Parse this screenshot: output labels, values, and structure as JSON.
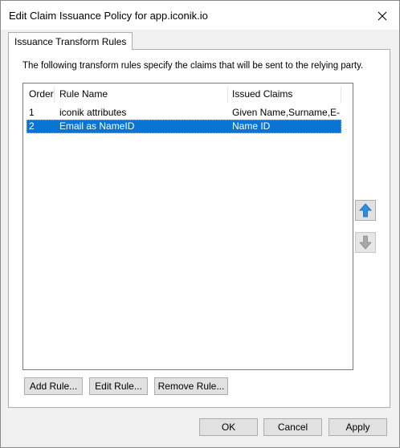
{
  "window": {
    "title": "Edit Claim Issuance Policy for app.iconik.io"
  },
  "tabs": [
    {
      "label": "Issuance Transform Rules"
    }
  ],
  "panel": {
    "description": "The following transform rules specify the claims that will be sent to the relying party."
  },
  "rules_table": {
    "columns": [
      "Order",
      "Rule Name",
      "Issued Claims"
    ],
    "rows": [
      {
        "order": "1",
        "name": "iconik attributes",
        "claims": "Given Name,Surname,E-...",
        "selected": false
      },
      {
        "order": "2",
        "name": "Email as NameID",
        "claims": "Name ID",
        "selected": true
      }
    ]
  },
  "move_buttons": {
    "up": {
      "icon": "arrow-up-icon",
      "enabled": true,
      "color": "#2e8fe0"
    },
    "down": {
      "icon": "arrow-down-icon",
      "enabled": false,
      "color": "#9a9a9a"
    }
  },
  "rule_buttons": {
    "add": "Add Rule...",
    "edit": "Edit Rule...",
    "remove": "Remove Rule..."
  },
  "dialog_buttons": {
    "ok": "OK",
    "cancel": "Cancel",
    "apply": "Apply"
  },
  "colors": {
    "selection": "#0a74d3",
    "window_bg": "#f0f0f0"
  }
}
